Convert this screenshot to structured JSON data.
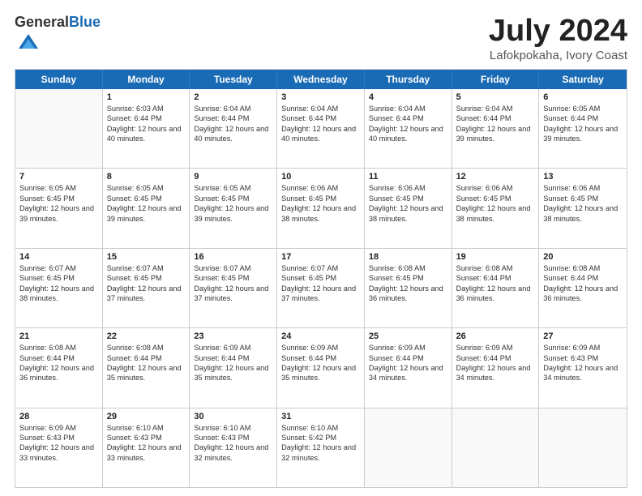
{
  "header": {
    "logo_general": "General",
    "logo_blue": "Blue",
    "month": "July 2024",
    "location": "Lafokpokaha, Ivory Coast"
  },
  "weekdays": [
    "Sunday",
    "Monday",
    "Tuesday",
    "Wednesday",
    "Thursday",
    "Friday",
    "Saturday"
  ],
  "rows": [
    [
      {
        "day": "",
        "sunrise": "",
        "sunset": "",
        "daylight": ""
      },
      {
        "day": "1",
        "sunrise": "Sunrise: 6:03 AM",
        "sunset": "Sunset: 6:44 PM",
        "daylight": "Daylight: 12 hours and 40 minutes."
      },
      {
        "day": "2",
        "sunrise": "Sunrise: 6:04 AM",
        "sunset": "Sunset: 6:44 PM",
        "daylight": "Daylight: 12 hours and 40 minutes."
      },
      {
        "day": "3",
        "sunrise": "Sunrise: 6:04 AM",
        "sunset": "Sunset: 6:44 PM",
        "daylight": "Daylight: 12 hours and 40 minutes."
      },
      {
        "day": "4",
        "sunrise": "Sunrise: 6:04 AM",
        "sunset": "Sunset: 6:44 PM",
        "daylight": "Daylight: 12 hours and 40 minutes."
      },
      {
        "day": "5",
        "sunrise": "Sunrise: 6:04 AM",
        "sunset": "Sunset: 6:44 PM",
        "daylight": "Daylight: 12 hours and 39 minutes."
      },
      {
        "day": "6",
        "sunrise": "Sunrise: 6:05 AM",
        "sunset": "Sunset: 6:44 PM",
        "daylight": "Daylight: 12 hours and 39 minutes."
      }
    ],
    [
      {
        "day": "7",
        "sunrise": "Sunrise: 6:05 AM",
        "sunset": "Sunset: 6:45 PM",
        "daylight": "Daylight: 12 hours and 39 minutes."
      },
      {
        "day": "8",
        "sunrise": "Sunrise: 6:05 AM",
        "sunset": "Sunset: 6:45 PM",
        "daylight": "Daylight: 12 hours and 39 minutes."
      },
      {
        "day": "9",
        "sunrise": "Sunrise: 6:05 AM",
        "sunset": "Sunset: 6:45 PM",
        "daylight": "Daylight: 12 hours and 39 minutes."
      },
      {
        "day": "10",
        "sunrise": "Sunrise: 6:06 AM",
        "sunset": "Sunset: 6:45 PM",
        "daylight": "Daylight: 12 hours and 38 minutes."
      },
      {
        "day": "11",
        "sunrise": "Sunrise: 6:06 AM",
        "sunset": "Sunset: 6:45 PM",
        "daylight": "Daylight: 12 hours and 38 minutes."
      },
      {
        "day": "12",
        "sunrise": "Sunrise: 6:06 AM",
        "sunset": "Sunset: 6:45 PM",
        "daylight": "Daylight: 12 hours and 38 minutes."
      },
      {
        "day": "13",
        "sunrise": "Sunrise: 6:06 AM",
        "sunset": "Sunset: 6:45 PM",
        "daylight": "Daylight: 12 hours and 38 minutes."
      }
    ],
    [
      {
        "day": "14",
        "sunrise": "Sunrise: 6:07 AM",
        "sunset": "Sunset: 6:45 PM",
        "daylight": "Daylight: 12 hours and 38 minutes."
      },
      {
        "day": "15",
        "sunrise": "Sunrise: 6:07 AM",
        "sunset": "Sunset: 6:45 PM",
        "daylight": "Daylight: 12 hours and 37 minutes."
      },
      {
        "day": "16",
        "sunrise": "Sunrise: 6:07 AM",
        "sunset": "Sunset: 6:45 PM",
        "daylight": "Daylight: 12 hours and 37 minutes."
      },
      {
        "day": "17",
        "sunrise": "Sunrise: 6:07 AM",
        "sunset": "Sunset: 6:45 PM",
        "daylight": "Daylight: 12 hours and 37 minutes."
      },
      {
        "day": "18",
        "sunrise": "Sunrise: 6:08 AM",
        "sunset": "Sunset: 6:45 PM",
        "daylight": "Daylight: 12 hours and 36 minutes."
      },
      {
        "day": "19",
        "sunrise": "Sunrise: 6:08 AM",
        "sunset": "Sunset: 6:44 PM",
        "daylight": "Daylight: 12 hours and 36 minutes."
      },
      {
        "day": "20",
        "sunrise": "Sunrise: 6:08 AM",
        "sunset": "Sunset: 6:44 PM",
        "daylight": "Daylight: 12 hours and 36 minutes."
      }
    ],
    [
      {
        "day": "21",
        "sunrise": "Sunrise: 6:08 AM",
        "sunset": "Sunset: 6:44 PM",
        "daylight": "Daylight: 12 hours and 36 minutes."
      },
      {
        "day": "22",
        "sunrise": "Sunrise: 6:08 AM",
        "sunset": "Sunset: 6:44 PM",
        "daylight": "Daylight: 12 hours and 35 minutes."
      },
      {
        "day": "23",
        "sunrise": "Sunrise: 6:09 AM",
        "sunset": "Sunset: 6:44 PM",
        "daylight": "Daylight: 12 hours and 35 minutes."
      },
      {
        "day": "24",
        "sunrise": "Sunrise: 6:09 AM",
        "sunset": "Sunset: 6:44 PM",
        "daylight": "Daylight: 12 hours and 35 minutes."
      },
      {
        "day": "25",
        "sunrise": "Sunrise: 6:09 AM",
        "sunset": "Sunset: 6:44 PM",
        "daylight": "Daylight: 12 hours and 34 minutes."
      },
      {
        "day": "26",
        "sunrise": "Sunrise: 6:09 AM",
        "sunset": "Sunset: 6:44 PM",
        "daylight": "Daylight: 12 hours and 34 minutes."
      },
      {
        "day": "27",
        "sunrise": "Sunrise: 6:09 AM",
        "sunset": "Sunset: 6:43 PM",
        "daylight": "Daylight: 12 hours and 34 minutes."
      }
    ],
    [
      {
        "day": "28",
        "sunrise": "Sunrise: 6:09 AM",
        "sunset": "Sunset: 6:43 PM",
        "daylight": "Daylight: 12 hours and 33 minutes."
      },
      {
        "day": "29",
        "sunrise": "Sunrise: 6:10 AM",
        "sunset": "Sunset: 6:43 PM",
        "daylight": "Daylight: 12 hours and 33 minutes."
      },
      {
        "day": "30",
        "sunrise": "Sunrise: 6:10 AM",
        "sunset": "Sunset: 6:43 PM",
        "daylight": "Daylight: 12 hours and 32 minutes."
      },
      {
        "day": "31",
        "sunrise": "Sunrise: 6:10 AM",
        "sunset": "Sunset: 6:42 PM",
        "daylight": "Daylight: 12 hours and 32 minutes."
      },
      {
        "day": "",
        "sunrise": "",
        "sunset": "",
        "daylight": ""
      },
      {
        "day": "",
        "sunrise": "",
        "sunset": "",
        "daylight": ""
      },
      {
        "day": "",
        "sunrise": "",
        "sunset": "",
        "daylight": ""
      }
    ]
  ]
}
